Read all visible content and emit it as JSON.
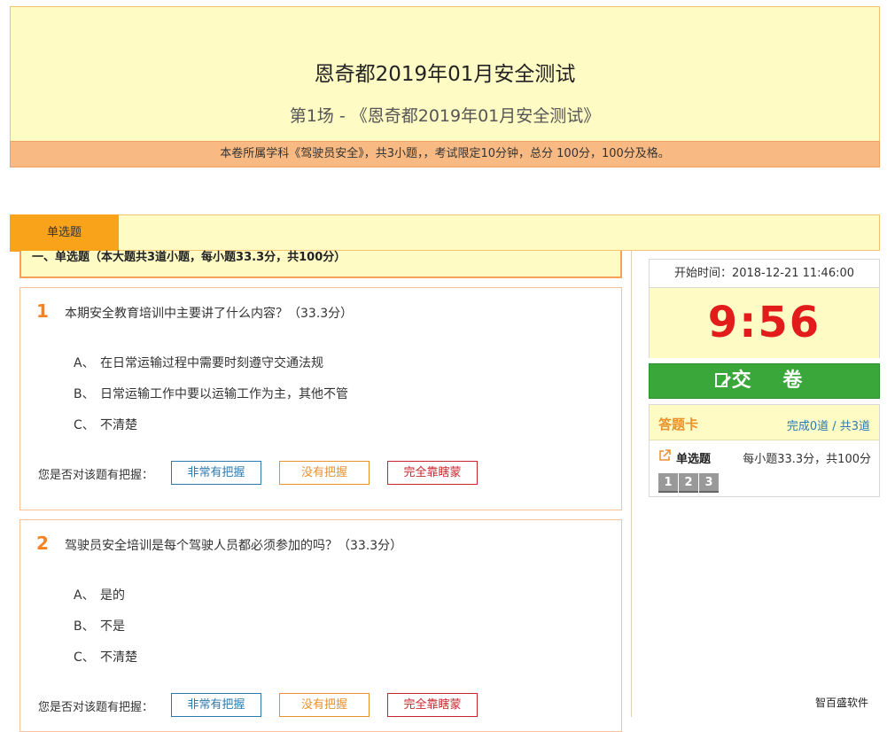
{
  "header": {
    "title": "恩奇都2019年01月安全测试",
    "subtitle": "第1场 - 《恩奇都2019年01月安全测试》",
    "info": "本卷所属学科《驾驶员安全》，共3小题，，考试限定10分钟，总分 100分，100分及格。"
  },
  "tab": {
    "label": "单选题"
  },
  "section": {
    "heading": "一、单选题（本大题共3道小题，每小题33.3分，共100分）"
  },
  "questions": [
    {
      "number": "1",
      "text": "本期安全教育培训中主要讲了什么内容？（33.3分）",
      "options": [
        {
          "letter": "A、",
          "text": "在日常运输过程中需要时刻遵守交通法规"
        },
        {
          "letter": "B、",
          "text": "日常运输工作中要以运输工作为主，其他不管"
        },
        {
          "letter": "C、",
          "text": "不清楚"
        }
      ]
    },
    {
      "number": "2",
      "text": "驾驶员安全培训是每个驾驶人员都必须参加的吗？（33.3分）",
      "options": [
        {
          "letter": "A、",
          "text": "是的"
        },
        {
          "letter": "B、",
          "text": "不是"
        },
        {
          "letter": "C、",
          "text": "不清楚"
        }
      ]
    }
  ],
  "confidence": {
    "prompt": "您是否对该题有把握：",
    "very_sure": "非常有把握",
    "not_sure": "没有把握",
    "guess": "完全靠瞎蒙"
  },
  "timer": {
    "start_time": "开始时间：2018-12-21 11:46:00",
    "remaining": "9:56"
  },
  "submit": {
    "label": "交 卷",
    "icon": "edit-icon"
  },
  "answer_card": {
    "title": "答题卡",
    "progress": "完成0道 / 共3道",
    "category_icon": "external-link-icon",
    "category_name": "单选题",
    "category_desc": "每小题33.3分，共100分",
    "numbers": [
      "1",
      "2",
      "3"
    ]
  },
  "watermark": "智百盛软件",
  "colors": {
    "accent_orange": "#f9a31a",
    "header_bg": "#fefbc5",
    "timer_red": "#e21b1b",
    "submit_green": "#3aa73a",
    "link_blue": "#2a7ab0"
  }
}
